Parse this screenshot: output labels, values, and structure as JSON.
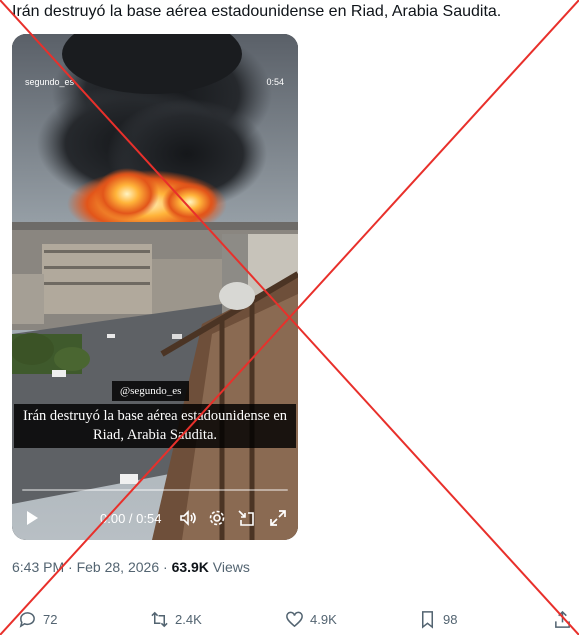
{
  "tweet": {
    "text": "Irán destruyó la base aérea estadounidense en Riad, Arabia Saudita."
  },
  "video": {
    "watermark_handle": "segundo_es",
    "duration_top": "0:54",
    "caption_handle": "@segundo_es",
    "caption_text": "Irán destruyó la base aérea estadounidense en Riad, Arabia Saudita.",
    "time_readout": "0:00 / 0:54",
    "progress_fraction": 0.0
  },
  "meta": {
    "time": "6:43 PM",
    "separator": " · ",
    "date": "Feb 28, 2026",
    "views_count": "63.9K",
    "views_label": " Views"
  },
  "actions": {
    "replies": "72",
    "reposts": "2.4K",
    "likes": "4.9K",
    "bookmarks": "98"
  },
  "colors": {
    "cross": "#e8302b",
    "muted": "#536471",
    "text": "#0f1419"
  }
}
